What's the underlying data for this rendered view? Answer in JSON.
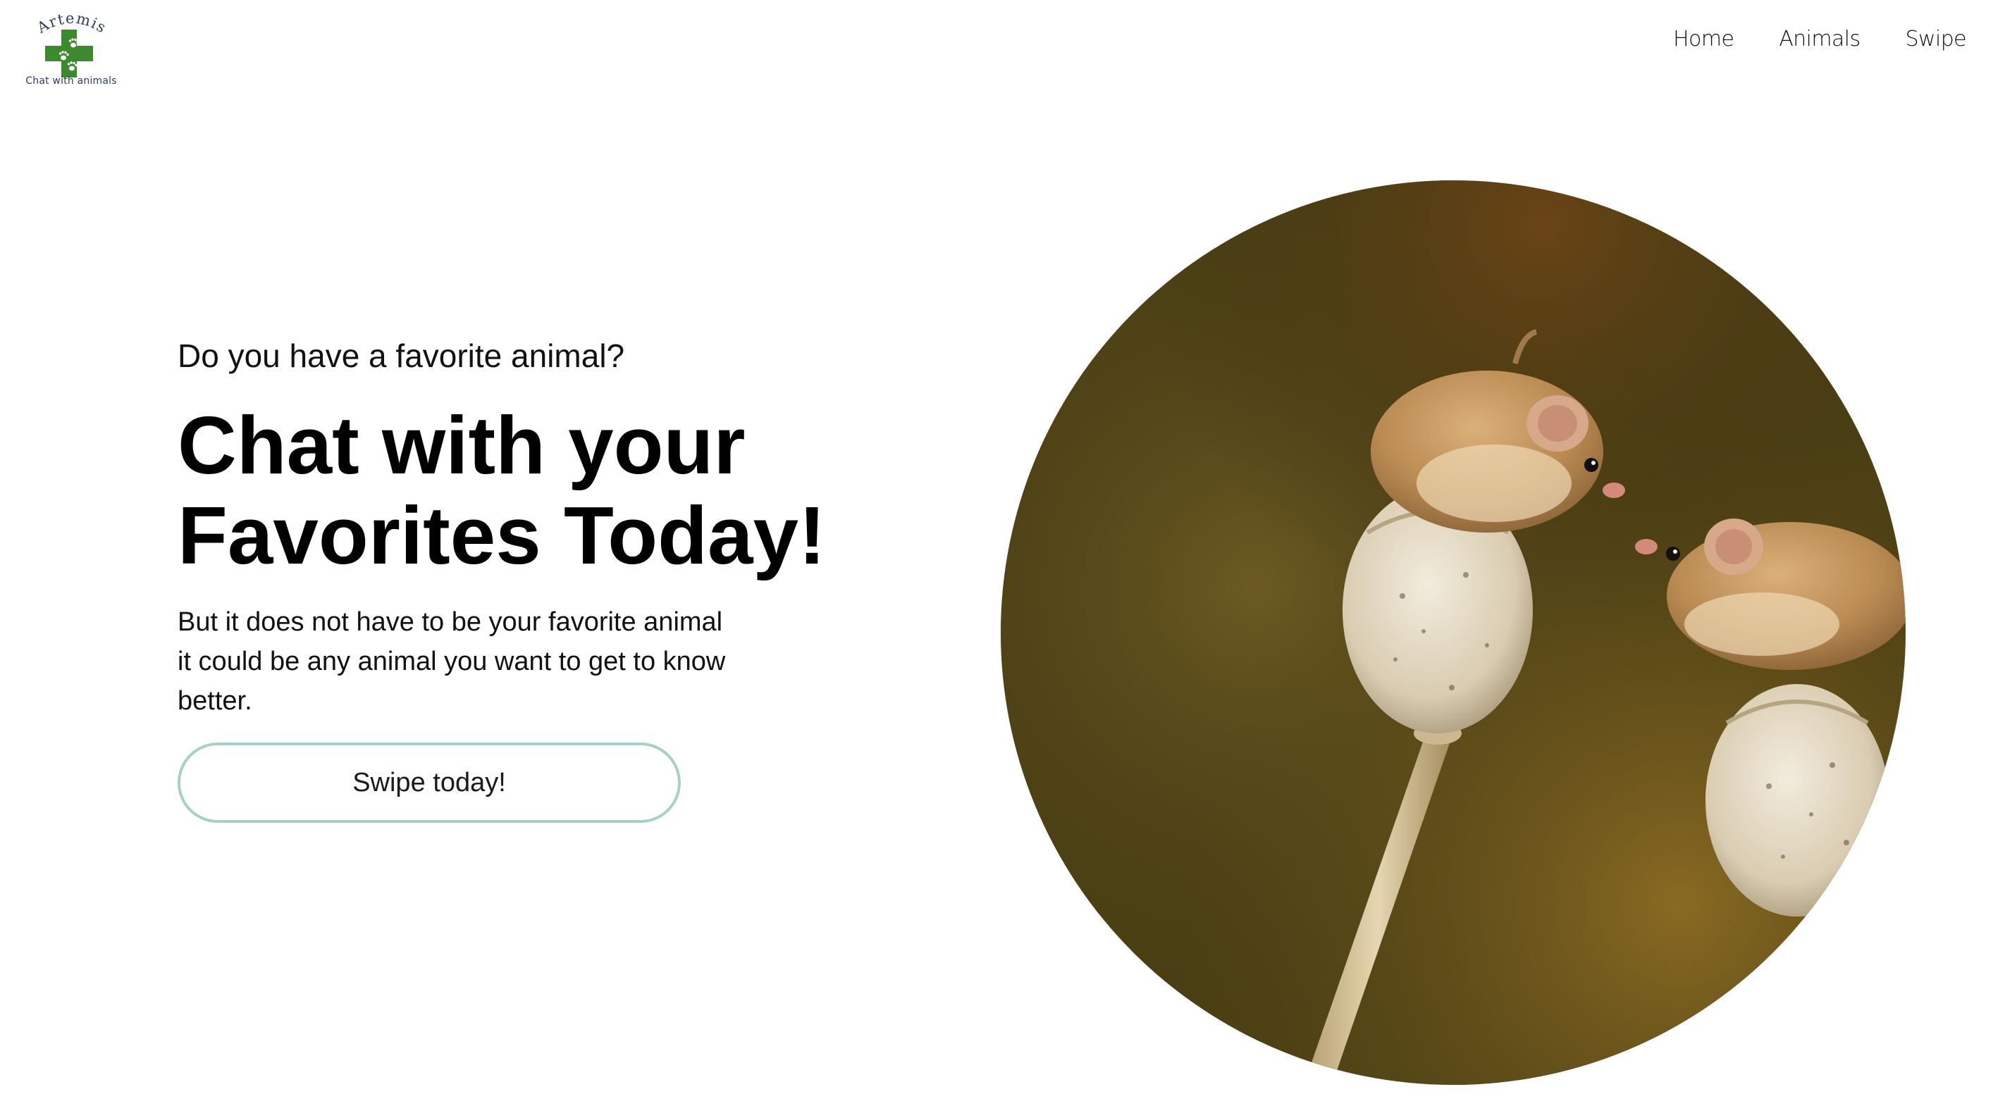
{
  "brand": {
    "name": "Artemis",
    "tagline": "Chat with animals",
    "colors": {
      "cross": "#3b8a2e",
      "text": "#2f3e5d"
    }
  },
  "nav": {
    "items": [
      {
        "label": "Home"
      },
      {
        "label": "Animals"
      },
      {
        "label": "Swipe"
      }
    ]
  },
  "hero": {
    "eyebrow": "Do you have a favorite animal?",
    "headline_line1": "Chat with your",
    "headline_line2": "Favorites Today!",
    "body_line1": "But it does not have to be your favorite animal",
    "body_line2": "it could be any animal you want to get to know",
    "body_line3": "better.",
    "cta_label": "Swipe today!",
    "cta_border_color": "#a6d2c4",
    "image_subject": "two harvest mice on poppy seed heads"
  }
}
